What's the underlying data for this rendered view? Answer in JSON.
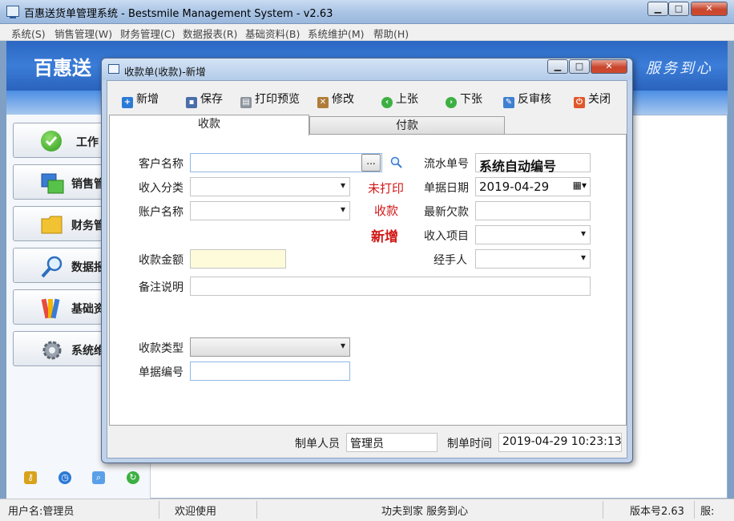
{
  "window": {
    "title": "百惠送货单管理系统 - Bestsmile Management System - v2.63",
    "controls": {
      "minimize": "▁",
      "maximize": "□",
      "close": "✕"
    }
  },
  "menu": [
    "系统(S)",
    "销售管理(W)",
    "财务管理(C)",
    "数据报表(R)",
    "基础资料(B)",
    "系统维护(M)",
    "帮助(H)"
  ],
  "banner": {
    "brand": "百惠送",
    "slogan": "服务到心"
  },
  "sidebar": {
    "items": [
      {
        "label": "工作",
        "icon": "check-icon"
      },
      {
        "label": "销售管",
        "icon": "windows-icon"
      },
      {
        "label": "财务管",
        "icon": "folder-icon"
      },
      {
        "label": "数据报",
        "icon": "magnifier-icon"
      },
      {
        "label": "基础资",
        "icon": "palette-icon"
      },
      {
        "label": "系统维",
        "icon": "gear-icon"
      }
    ],
    "tools": [
      "key-icon",
      "clock-icon",
      "search-icon",
      "refresh-icon"
    ]
  },
  "dialog": {
    "title": "收款单(收款)-新增",
    "toolbar": {
      "new": "新增",
      "save": "保存",
      "print_preview": "打印预览",
      "edit": "修改",
      "prev": "上张",
      "next": "下张",
      "unapprove": "反审核",
      "close": "关闭"
    },
    "tabs": {
      "receipt": "收款",
      "payment": "付款"
    },
    "form": {
      "customer_label": "客户名称",
      "customer_value": "",
      "customer_browse": "...",
      "serial_label": "流水单号",
      "serial_value": "系统自动编号",
      "income_type_label": "收入分类",
      "income_type_value": "",
      "doc_date_label": "单据日期",
      "doc_date_value": "2019-04-29",
      "account_label": "账户名称",
      "account_value": "",
      "latest_debt_label": "最新欠款",
      "latest_debt_value": "",
      "income_item_label": "收入项目",
      "income_item_value": "",
      "amount_label": "收款金额",
      "amount_value": "",
      "handler_label": "经手人",
      "handler_value": "",
      "remark_label": "备注说明",
      "remark_value": "",
      "receipt_type_label": "收款类型",
      "receipt_type_value": "",
      "doc_no_label": "单据编号",
      "doc_no_value": "",
      "status_print": "未打印",
      "status_kind": "收款",
      "status_mode": "新增"
    },
    "footer": {
      "creator_label": "制单人员",
      "creator_value": "管理员",
      "created_time_label": "制单时间",
      "created_time_value": "2019-04-29 10:23:13"
    }
  },
  "status": {
    "user": "用户名:管理员",
    "welcome": "欢迎使用",
    "motto": "功夫到家 服务到心",
    "version": "版本号2.63",
    "more": "服:"
  }
}
